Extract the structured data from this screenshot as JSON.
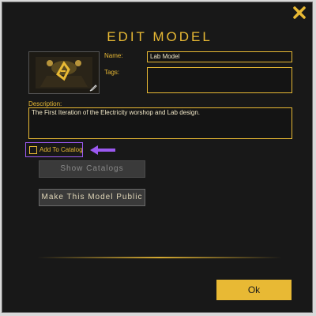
{
  "dialog": {
    "title": "EDIT MODEL",
    "name_label": "Name:",
    "name_value": "Lab Model",
    "tags_label": "Tags:",
    "tags_value": "",
    "description_label": "Description:",
    "description_value": "The First Iteration of the Electricity worshop and Lab design.",
    "add_to_catalog_label": "Add To Catalog",
    "add_to_catalog_checked": false,
    "show_catalogs_label": "Show Catalogs",
    "make_public_label": "Make This Model Public",
    "ok_label": "Ok"
  },
  "icons": {
    "close": "close-icon",
    "thumbnail": "model-thumbnail",
    "edit": "edit-icon",
    "arrow": "pointer-arrow-icon"
  },
  "colors": {
    "accent": "#e8b934",
    "background": "#181818",
    "highlight": "#9b59f0"
  }
}
